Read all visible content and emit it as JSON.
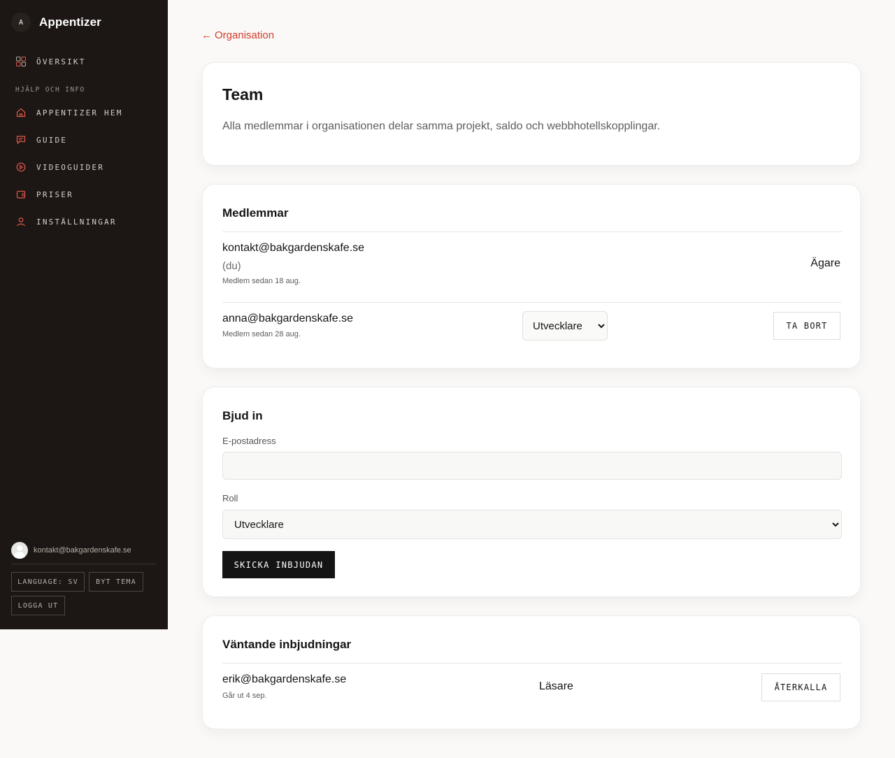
{
  "sidebar": {
    "logo_letter": "A",
    "brand": "Appentizer",
    "overview": "ÖVERSIKT",
    "section_help": "HJÄLP OCH INFO",
    "items": [
      {
        "label": "APPENTIZER HEM",
        "icon": "home-icon"
      },
      {
        "label": "GUIDE",
        "icon": "chat-icon"
      },
      {
        "label": "VIDEOGUIDER",
        "icon": "play-icon"
      },
      {
        "label": "PRISER",
        "icon": "wallet-icon"
      },
      {
        "label": "INSTÄLLNINGAR",
        "icon": "user-icon"
      }
    ],
    "user_email": "kontakt@bakgardenskafe.se",
    "language_btn": "LANGUAGE: SV",
    "theme_btn": "BYT TEMA",
    "logout_btn": "LOGGA UT"
  },
  "back_link": {
    "arrow": "←",
    "label": "Organisation"
  },
  "team": {
    "title": "Team",
    "description": "Alla medlemmar i organisationen delar samma projekt, saldo och webbhotellskopplingar."
  },
  "members": {
    "title": "Medlemmar",
    "rows": [
      {
        "email": "kontakt@bakgardenskafe.se",
        "you": "(du)",
        "since": "Medlem sedan 18 aug.",
        "role": "Ägare"
      },
      {
        "email": "anna@bakgardenskafe.se",
        "since": "Medlem sedan 28 aug.",
        "role": "Utvecklare",
        "remove": "TA BORT"
      }
    ]
  },
  "invite": {
    "title": "Bjud in",
    "email_label": "E-postadress",
    "email_value": "",
    "role_label": "Roll",
    "role_value": "Utvecklare",
    "submit": "SKICKA INBJUDAN"
  },
  "pending": {
    "title": "Väntande inbjudningar",
    "rows": [
      {
        "email": "erik@bakgardenskafe.se",
        "expires": "Går ut 4 sep.",
        "role": "Läsare",
        "revoke": "ÅTERKALLA"
      }
    ]
  },
  "colors": {
    "sidebar_bg": "#1c1714",
    "accent": "#d43c2b",
    "primary": "#141414"
  }
}
